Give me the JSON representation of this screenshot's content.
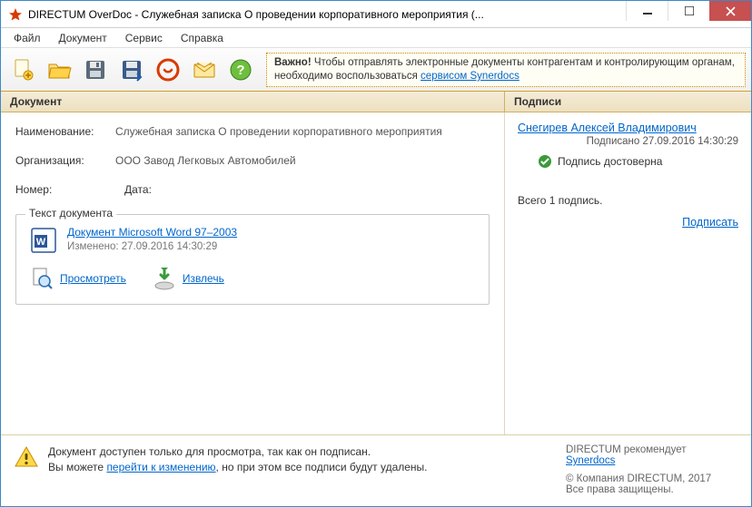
{
  "window": {
    "title": "DIRECTUM OverDoc - Служебная записка О проведении корпоративного мероприятия (..."
  },
  "menu": {
    "file": "Файл",
    "document": "Документ",
    "service": "Сервис",
    "help": "Справка"
  },
  "banner": {
    "prefix": "Важно!",
    "text": " Чтобы отправлять электронные документы контрагентам и контролирующим органам, необходимо воспользоваться ",
    "link": "сервисом Synerdocs"
  },
  "headers": {
    "document": "Документ",
    "signatures": "Подписи"
  },
  "fields": {
    "name_label": "Наименование:",
    "name_value": "Служебная записка О проведении корпоративного мероприятия",
    "org_label": "Организация:",
    "org_value": "ООО Завод Легковых Автомобилей",
    "number_label": "Номер:",
    "number_value": "",
    "date_label": "Дата:",
    "date_value": ""
  },
  "docbox": {
    "legend": "Текст документа",
    "doc_link": "Документ Microsoft Word 97–2003",
    "modified": "Изменено: 27.09.2016 14:30:29",
    "view": "Просмотреть",
    "extract": "Извлечь"
  },
  "signatures": {
    "signer": "Снегирев Алексей Владимирович",
    "signed_at": "Подписано 27.09.2016 14:30:29",
    "valid": "Подпись достоверна",
    "total": "Всего 1 подпись.",
    "sign_action": "Подписать"
  },
  "footer": {
    "line1": "Документ доступен только для просмотра, так как он подписан.",
    "line2a": "Вы можете ",
    "line2_link": "перейти к изменению",
    "line2b": ", но при этом все подписи будут удалены.",
    "recommends": "DIRECTUM рекомендует",
    "synerdocs": "Synerdocs",
    "copyright": "© Компания DIRECTUM, 2017",
    "rights": "Все права защищены."
  }
}
